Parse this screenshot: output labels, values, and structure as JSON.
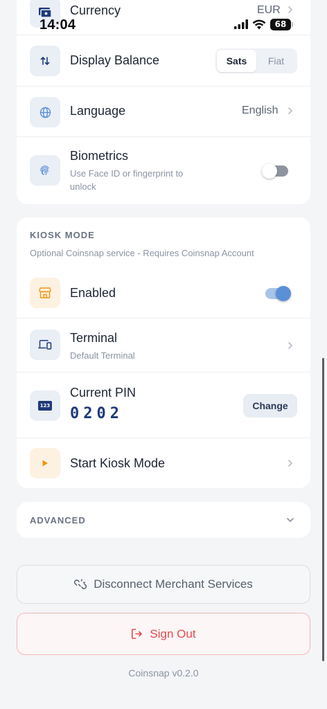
{
  "status": {
    "time": "14:04",
    "battery": "68"
  },
  "settings": {
    "currency": {
      "label": "Currency",
      "value": "EUR"
    },
    "display_balance": {
      "label": "Display Balance",
      "options": [
        "Sats",
        "Fiat"
      ],
      "selected": "Sats"
    },
    "language": {
      "label": "Language",
      "value": "English"
    },
    "biometrics": {
      "label": "Biometrics",
      "description": "Use Face ID or fingerprint to unlock",
      "enabled": false
    }
  },
  "kiosk": {
    "heading": "KIOSK MODE",
    "description": "Optional Coinsnap service - Requires Coinsnap Account",
    "enabled": {
      "label": "Enabled",
      "on": true
    },
    "terminal": {
      "label": "Terminal",
      "value": "Default Terminal"
    },
    "pin": {
      "label": "Current PIN",
      "value": "0202",
      "icon_text": "123",
      "change_label": "Change"
    },
    "start": {
      "label": "Start Kiosk Mode"
    }
  },
  "advanced": {
    "heading": "ADVANCED"
  },
  "actions": {
    "disconnect_label": "Disconnect Merchant Services",
    "signout_label": "Sign Out"
  },
  "footer": {
    "version": "Coinsnap v0.2.0"
  },
  "colors": {
    "accent_blue": "#5b8fd6",
    "danger": "#e5484d",
    "orange": "#f0960f",
    "text": "#1d2533"
  }
}
